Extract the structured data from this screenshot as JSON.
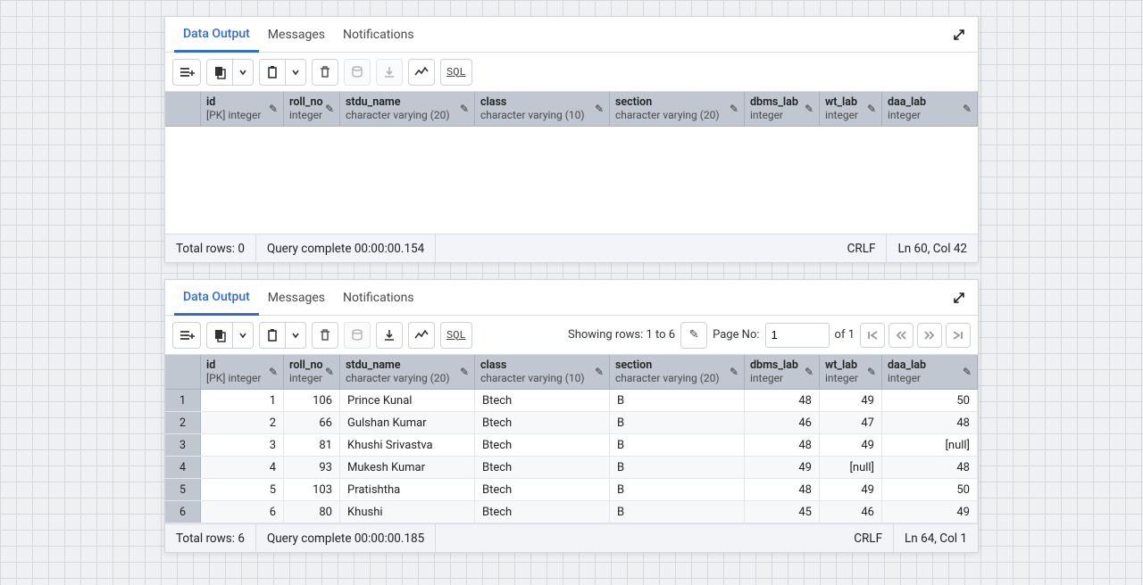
{
  "tabs": {
    "data_output": "Data Output",
    "messages": "Messages",
    "notifications": "Notifications"
  },
  "toolbar": {
    "sql": "SQL"
  },
  "columns": [
    {
      "name": "id",
      "type": "[PK] integer"
    },
    {
      "name": "roll_no",
      "type": "integer"
    },
    {
      "name": "stdu_name",
      "type": "character varying (20)"
    },
    {
      "name": "class",
      "type": "character varying (10)"
    },
    {
      "name": "section",
      "type": "character varying (20)"
    },
    {
      "name": "dbms_lab",
      "type": "integer"
    },
    {
      "name": "wt_lab",
      "type": "integer"
    },
    {
      "name": "daa_lab",
      "type": "integer"
    }
  ],
  "panel_top": {
    "status": {
      "total_rows": "Total rows: 0",
      "query": "Query complete 00:00:00.154",
      "crlf": "CRLF",
      "pos": "Ln 60, Col 42"
    }
  },
  "panel_bottom": {
    "showing": "Showing rows: 1 to 6",
    "page_label": "Page No:",
    "page_value": "1",
    "of_pages": "of 1",
    "status": {
      "total_rows": "Total rows: 6",
      "query": "Query complete 00:00:00.185",
      "crlf": "CRLF",
      "pos": "Ln 64, Col 1"
    },
    "rows": [
      {
        "n": "1",
        "id": "1",
        "roll_no": "106",
        "stdu_name": "Prince Kunal",
        "class": "Btech",
        "section": "B",
        "dbms_lab": "48",
        "wt_lab": "49",
        "daa_lab": "50"
      },
      {
        "n": "2",
        "id": "2",
        "roll_no": "66",
        "stdu_name": "Gulshan Kumar",
        "class": "Btech",
        "section": "B",
        "dbms_lab": "46",
        "wt_lab": "47",
        "daa_lab": "48"
      },
      {
        "n": "3",
        "id": "3",
        "roll_no": "81",
        "stdu_name": "Khushi Srivastva",
        "class": "Btech",
        "section": "B",
        "dbms_lab": "48",
        "wt_lab": "49",
        "daa_lab": "[null]"
      },
      {
        "n": "4",
        "id": "4",
        "roll_no": "93",
        "stdu_name": "Mukesh Kumar",
        "class": "Btech",
        "section": "B",
        "dbms_lab": "49",
        "wt_lab": "[null]",
        "daa_lab": "48"
      },
      {
        "n": "5",
        "id": "5",
        "roll_no": "103",
        "stdu_name": "Pratishtha",
        "class": "Btech",
        "section": "B",
        "dbms_lab": "48",
        "wt_lab": "49",
        "daa_lab": "50"
      },
      {
        "n": "6",
        "id": "6",
        "roll_no": "80",
        "stdu_name": "Khushi",
        "class": "Btech",
        "section": "B",
        "dbms_lab": "45",
        "wt_lab": "46",
        "daa_lab": "49"
      }
    ]
  }
}
